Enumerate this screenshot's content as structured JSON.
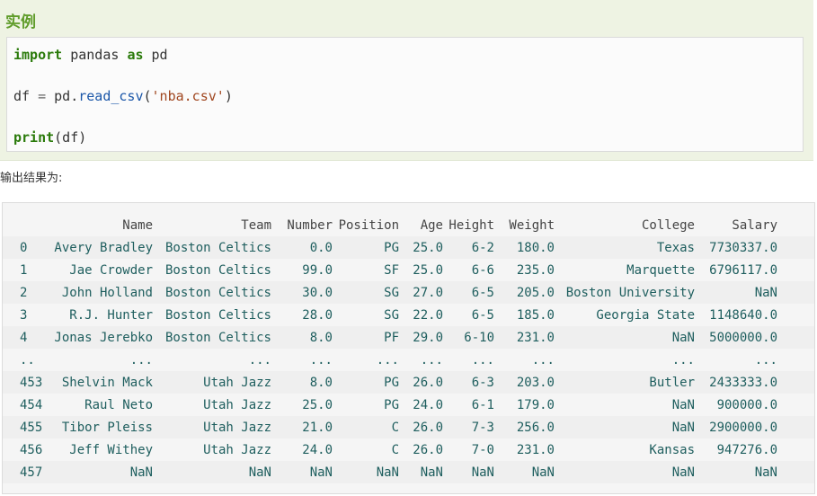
{
  "example": {
    "title": "实例",
    "code": {
      "line1": {
        "kw1": "import",
        "mid": " pandas ",
        "kw2": "as",
        "end": " pd"
      },
      "line2": {
        "a": "df ",
        "eq": "=",
        "b": " pd.",
        "fn": "read_csv",
        "p1": "(",
        "str": "'nba.csv'",
        "p2": ")"
      },
      "line3": {
        "fn": "print",
        "rest": "(df)"
      }
    }
  },
  "output_label": "输出结果为:",
  "table": {
    "columns": [
      "Name",
      "Team",
      "Number",
      "Position",
      "Age",
      "Height",
      "Weight",
      "College",
      "Salary"
    ],
    "rows": [
      [
        "0",
        "Avery Bradley",
        "Boston Celtics",
        "0.0",
        "PG",
        "25.0",
        "6-2",
        "180.0",
        "Texas",
        "7730337.0"
      ],
      [
        "1",
        "Jae Crowder",
        "Boston Celtics",
        "99.0",
        "SF",
        "25.0",
        "6-6",
        "235.0",
        "Marquette",
        "6796117.0"
      ],
      [
        "2",
        "John Holland",
        "Boston Celtics",
        "30.0",
        "SG",
        "27.0",
        "6-5",
        "205.0",
        "Boston University",
        "NaN"
      ],
      [
        "3",
        "R.J. Hunter",
        "Boston Celtics",
        "28.0",
        "SG",
        "22.0",
        "6-5",
        "185.0",
        "Georgia State",
        "1148640.0"
      ],
      [
        "4",
        "Jonas Jerebko",
        "Boston Celtics",
        "8.0",
        "PF",
        "29.0",
        "6-10",
        "231.0",
        "NaN",
        "5000000.0"
      ],
      [
        "..",
        "...",
        "...",
        "...",
        "...",
        "...",
        "...",
        "...",
        "...",
        "..."
      ],
      [
        "453",
        "Shelvin Mack",
        "Utah Jazz",
        "8.0",
        "PG",
        "26.0",
        "6-3",
        "203.0",
        "Butler",
        "2433333.0"
      ],
      [
        "454",
        "Raul Neto",
        "Utah Jazz",
        "25.0",
        "PG",
        "24.0",
        "6-1",
        "179.0",
        "NaN",
        "900000.0"
      ],
      [
        "455",
        "Tibor Pleiss",
        "Utah Jazz",
        "21.0",
        "C",
        "26.0",
        "7-3",
        "256.0",
        "NaN",
        "2900000.0"
      ],
      [
        "456",
        "Jeff Withey",
        "Utah Jazz",
        "24.0",
        "C",
        "26.0",
        "7-0",
        "231.0",
        "Kansas",
        "947276.0"
      ],
      [
        "457",
        "NaN",
        "NaN",
        "NaN",
        "NaN",
        "NaN",
        "NaN",
        "NaN",
        "NaN",
        "NaN"
      ]
    ]
  }
}
